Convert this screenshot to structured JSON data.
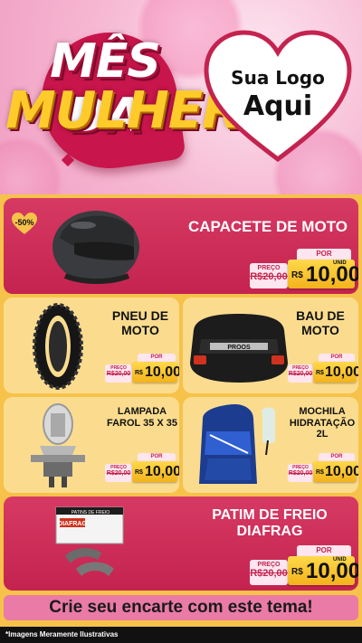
{
  "header": {
    "title_line1": "MÊS DA",
    "title_line2": "MULHER",
    "logo_line1": "Sua Logo",
    "logo_line2": "Aqui"
  },
  "discount_badge": "-50%",
  "products": [
    {
      "name": "CAPACETE DE MOTO",
      "de_label": "PREÇO",
      "de_price": "R$20,00",
      "por_label": "POR",
      "currency": "R$",
      "price": "10,00",
      "unit": "UNID"
    },
    {
      "name": "PNEU DE MOTO",
      "de_label": "PREÇO",
      "de_price": "R$20,00",
      "por_label": "POR",
      "currency": "R$",
      "price": "10,00"
    },
    {
      "name": "BAU DE MOTO",
      "de_label": "PREÇO",
      "de_price": "R$20,00",
      "por_label": "POR",
      "currency": "R$",
      "price": "10,00"
    },
    {
      "name": "LAMPADA FAROL 35 X 35",
      "de_label": "PREÇO",
      "de_price": "R$20,00",
      "por_label": "POR",
      "currency": "R$",
      "price": "10,00"
    },
    {
      "name": "MOCHILA HIDRATAÇÃO 2L",
      "de_label": "PREÇO",
      "de_price": "R$20,00",
      "por_label": "POR",
      "currency": "R$",
      "price": "10,00"
    },
    {
      "name": "PATIM DE FREIO DIAFRAG",
      "de_label": "PREÇO",
      "de_price": "R$20,00",
      "por_label": "POR",
      "currency": "R$",
      "price": "10,00",
      "unit": "UNID"
    }
  ],
  "images": {
    "box_brand": "PROOS",
    "pads_brand": "DIAFRAG",
    "pads_box_text": "PATINS DE FREIO"
  },
  "footer": {
    "cta": "Crie seu encarte com este tema!",
    "disclaimer": "*Imagens Meramente Ilustrativas"
  },
  "colors": {
    "accent_red": "#c4234f",
    "accent_yellow": "#f7c24a",
    "price_gold": "#f3b21c",
    "pink_bg": "#f4c9dc"
  }
}
